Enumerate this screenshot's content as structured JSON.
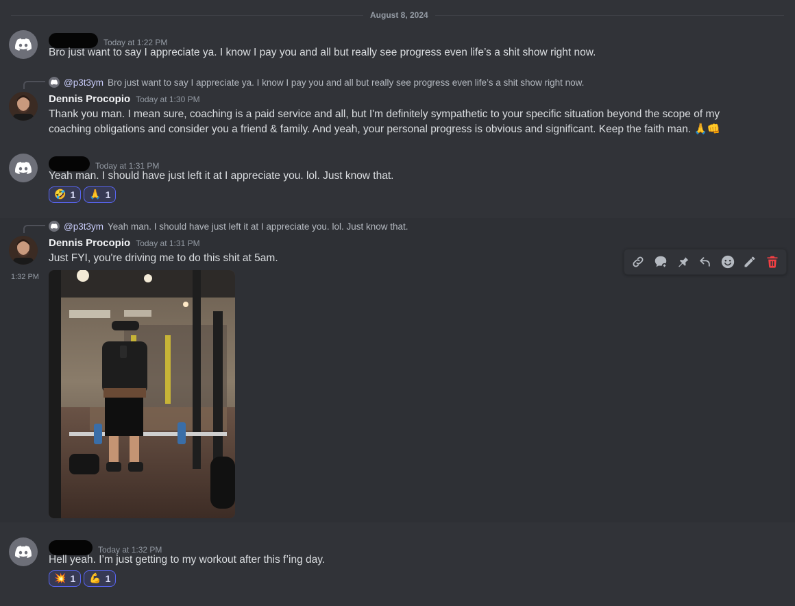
{
  "date_divider": "August 8, 2024",
  "messages": [
    {
      "timestamp": "Today at 1:22 PM",
      "text": "Bro just want to say I appreciate ya. I know I pay you and all but really see progress even life’s a shit show right now."
    },
    {
      "reply": {
        "mention": "@p3t3ym",
        "text": "Bro just want to say I appreciate ya. I know I pay you and all but really see progress even life’s a shit show right now."
      },
      "author": "Dennis Procopio",
      "timestamp": "Today at 1:30 PM",
      "text": "Thank you man. I mean sure, coaching is a paid service and all, but I'm definitely sympathetic to your specific situation beyond the scope of my coaching obligations and consider you a friend & family. And yeah, your personal progress is obvious and significant. Keep the faith man. 🙏👊"
    },
    {
      "timestamp": "Today at 1:31 PM",
      "text": "Yeah man. I should have just left it at I appreciate you. lol. Just know that.",
      "reactions": [
        {
          "emoji": "🤣",
          "count": "1"
        },
        {
          "emoji": "🙏",
          "count": "1"
        }
      ]
    },
    {
      "reply": {
        "mention": "@p3t3ym",
        "text": "Yeah man. I should have just left it at I appreciate you. lol. Just know that."
      },
      "author": "Dennis Procopio",
      "timestamp": "Today at 1:31 PM",
      "text": "Just FYI, you're driving me to do this shit at 5am.",
      "followup_timestamp": "1:32 PM"
    },
    {
      "timestamp": "Today at 1:32 PM",
      "text": "Hell yeah. I’m just getting to my workout after this f’ing day.",
      "reactions": [
        {
          "emoji": "💥",
          "count": "1"
        },
        {
          "emoji": "💪",
          "count": "1"
        }
      ]
    }
  ],
  "toolbar": {
    "icons": [
      "link-icon",
      "thread-icon",
      "pin-icon",
      "reply-icon",
      "emoji-icon",
      "edit-icon",
      "delete-icon"
    ]
  },
  "colors": {
    "background": "#313338",
    "reaction_border": "#5865f2",
    "danger": "#f23f43"
  }
}
